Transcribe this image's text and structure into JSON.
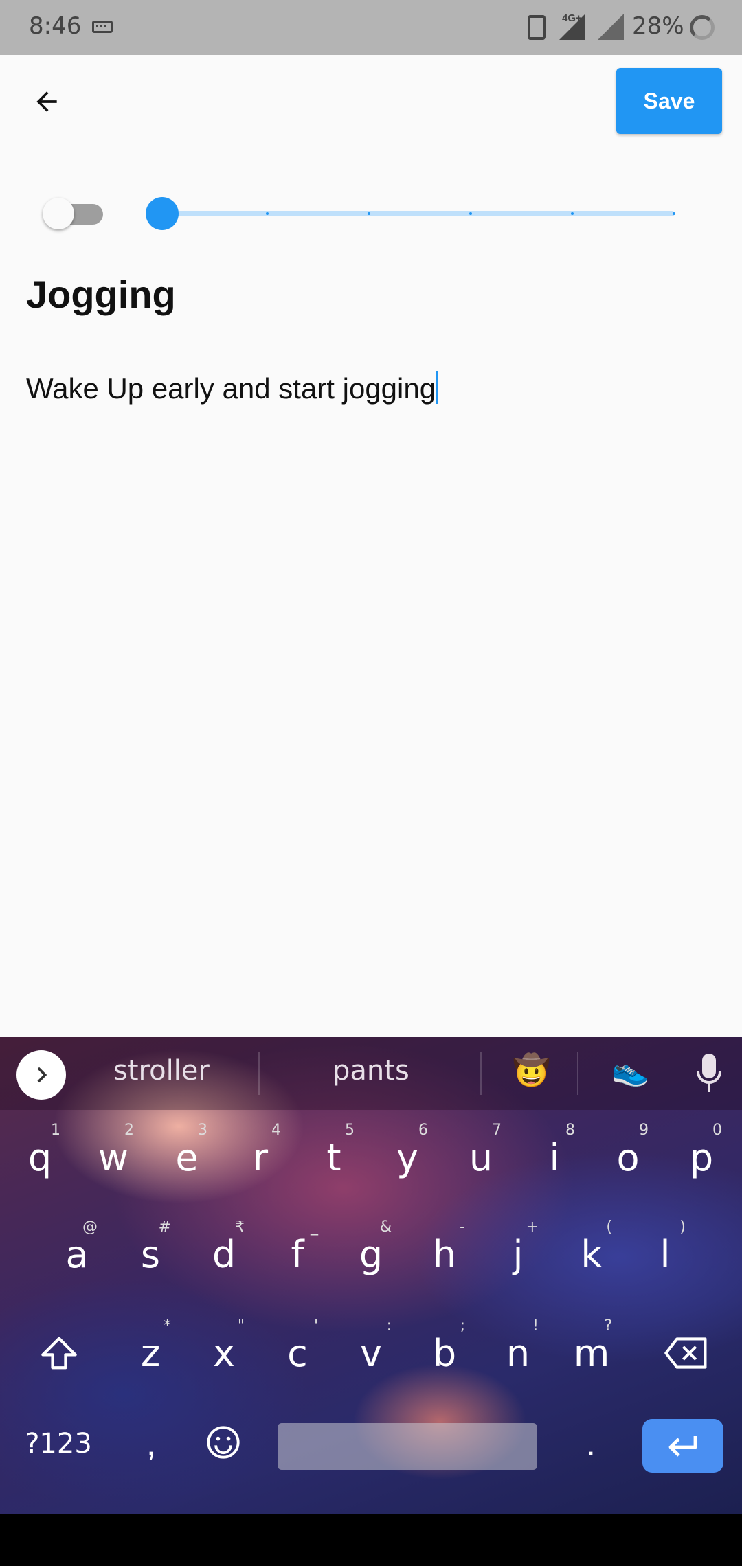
{
  "status_bar": {
    "time": "8:46",
    "network": "4G+",
    "battery_percent": "28%"
  },
  "app_bar": {
    "back_icon": "arrow-back-icon",
    "save_label": "Save"
  },
  "controls": {
    "toggle_on": false,
    "slider_value_index": 0,
    "slider_steps": 6,
    "accent_color": "#2196f3"
  },
  "note": {
    "title": "Jogging",
    "body": "Wake Up early and start jogging"
  },
  "keyboard": {
    "suggestions": [
      "stroller",
      "pants"
    ],
    "emoji_suggestions": [
      "🤠",
      "👟"
    ],
    "row1": [
      {
        "key": "q",
        "hint": "1"
      },
      {
        "key": "w",
        "hint": "2"
      },
      {
        "key": "e",
        "hint": "3"
      },
      {
        "key": "r",
        "hint": "4"
      },
      {
        "key": "t",
        "hint": "5"
      },
      {
        "key": "y",
        "hint": "6"
      },
      {
        "key": "u",
        "hint": "7"
      },
      {
        "key": "i",
        "hint": "8"
      },
      {
        "key": "o",
        "hint": "9"
      },
      {
        "key": "p",
        "hint": "0"
      }
    ],
    "row2": [
      {
        "key": "a",
        "hint": "@"
      },
      {
        "key": "s",
        "hint": "#"
      },
      {
        "key": "d",
        "hint": "₹"
      },
      {
        "key": "f",
        "hint": "_"
      },
      {
        "key": "g",
        "hint": "&"
      },
      {
        "key": "h",
        "hint": "-"
      },
      {
        "key": "j",
        "hint": "+"
      },
      {
        "key": "k",
        "hint": "("
      },
      {
        "key": "l",
        "hint": ")"
      }
    ],
    "row3": [
      {
        "key": "z",
        "hint": "*"
      },
      {
        "key": "x",
        "hint": "\""
      },
      {
        "key": "c",
        "hint": "'"
      },
      {
        "key": "v",
        "hint": ":"
      },
      {
        "key": "b",
        "hint": ";"
      },
      {
        "key": "n",
        "hint": "!"
      },
      {
        "key": "m",
        "hint": "?"
      }
    ],
    "symbols_label": "?123",
    "comma_label": ",",
    "period_label": "."
  }
}
